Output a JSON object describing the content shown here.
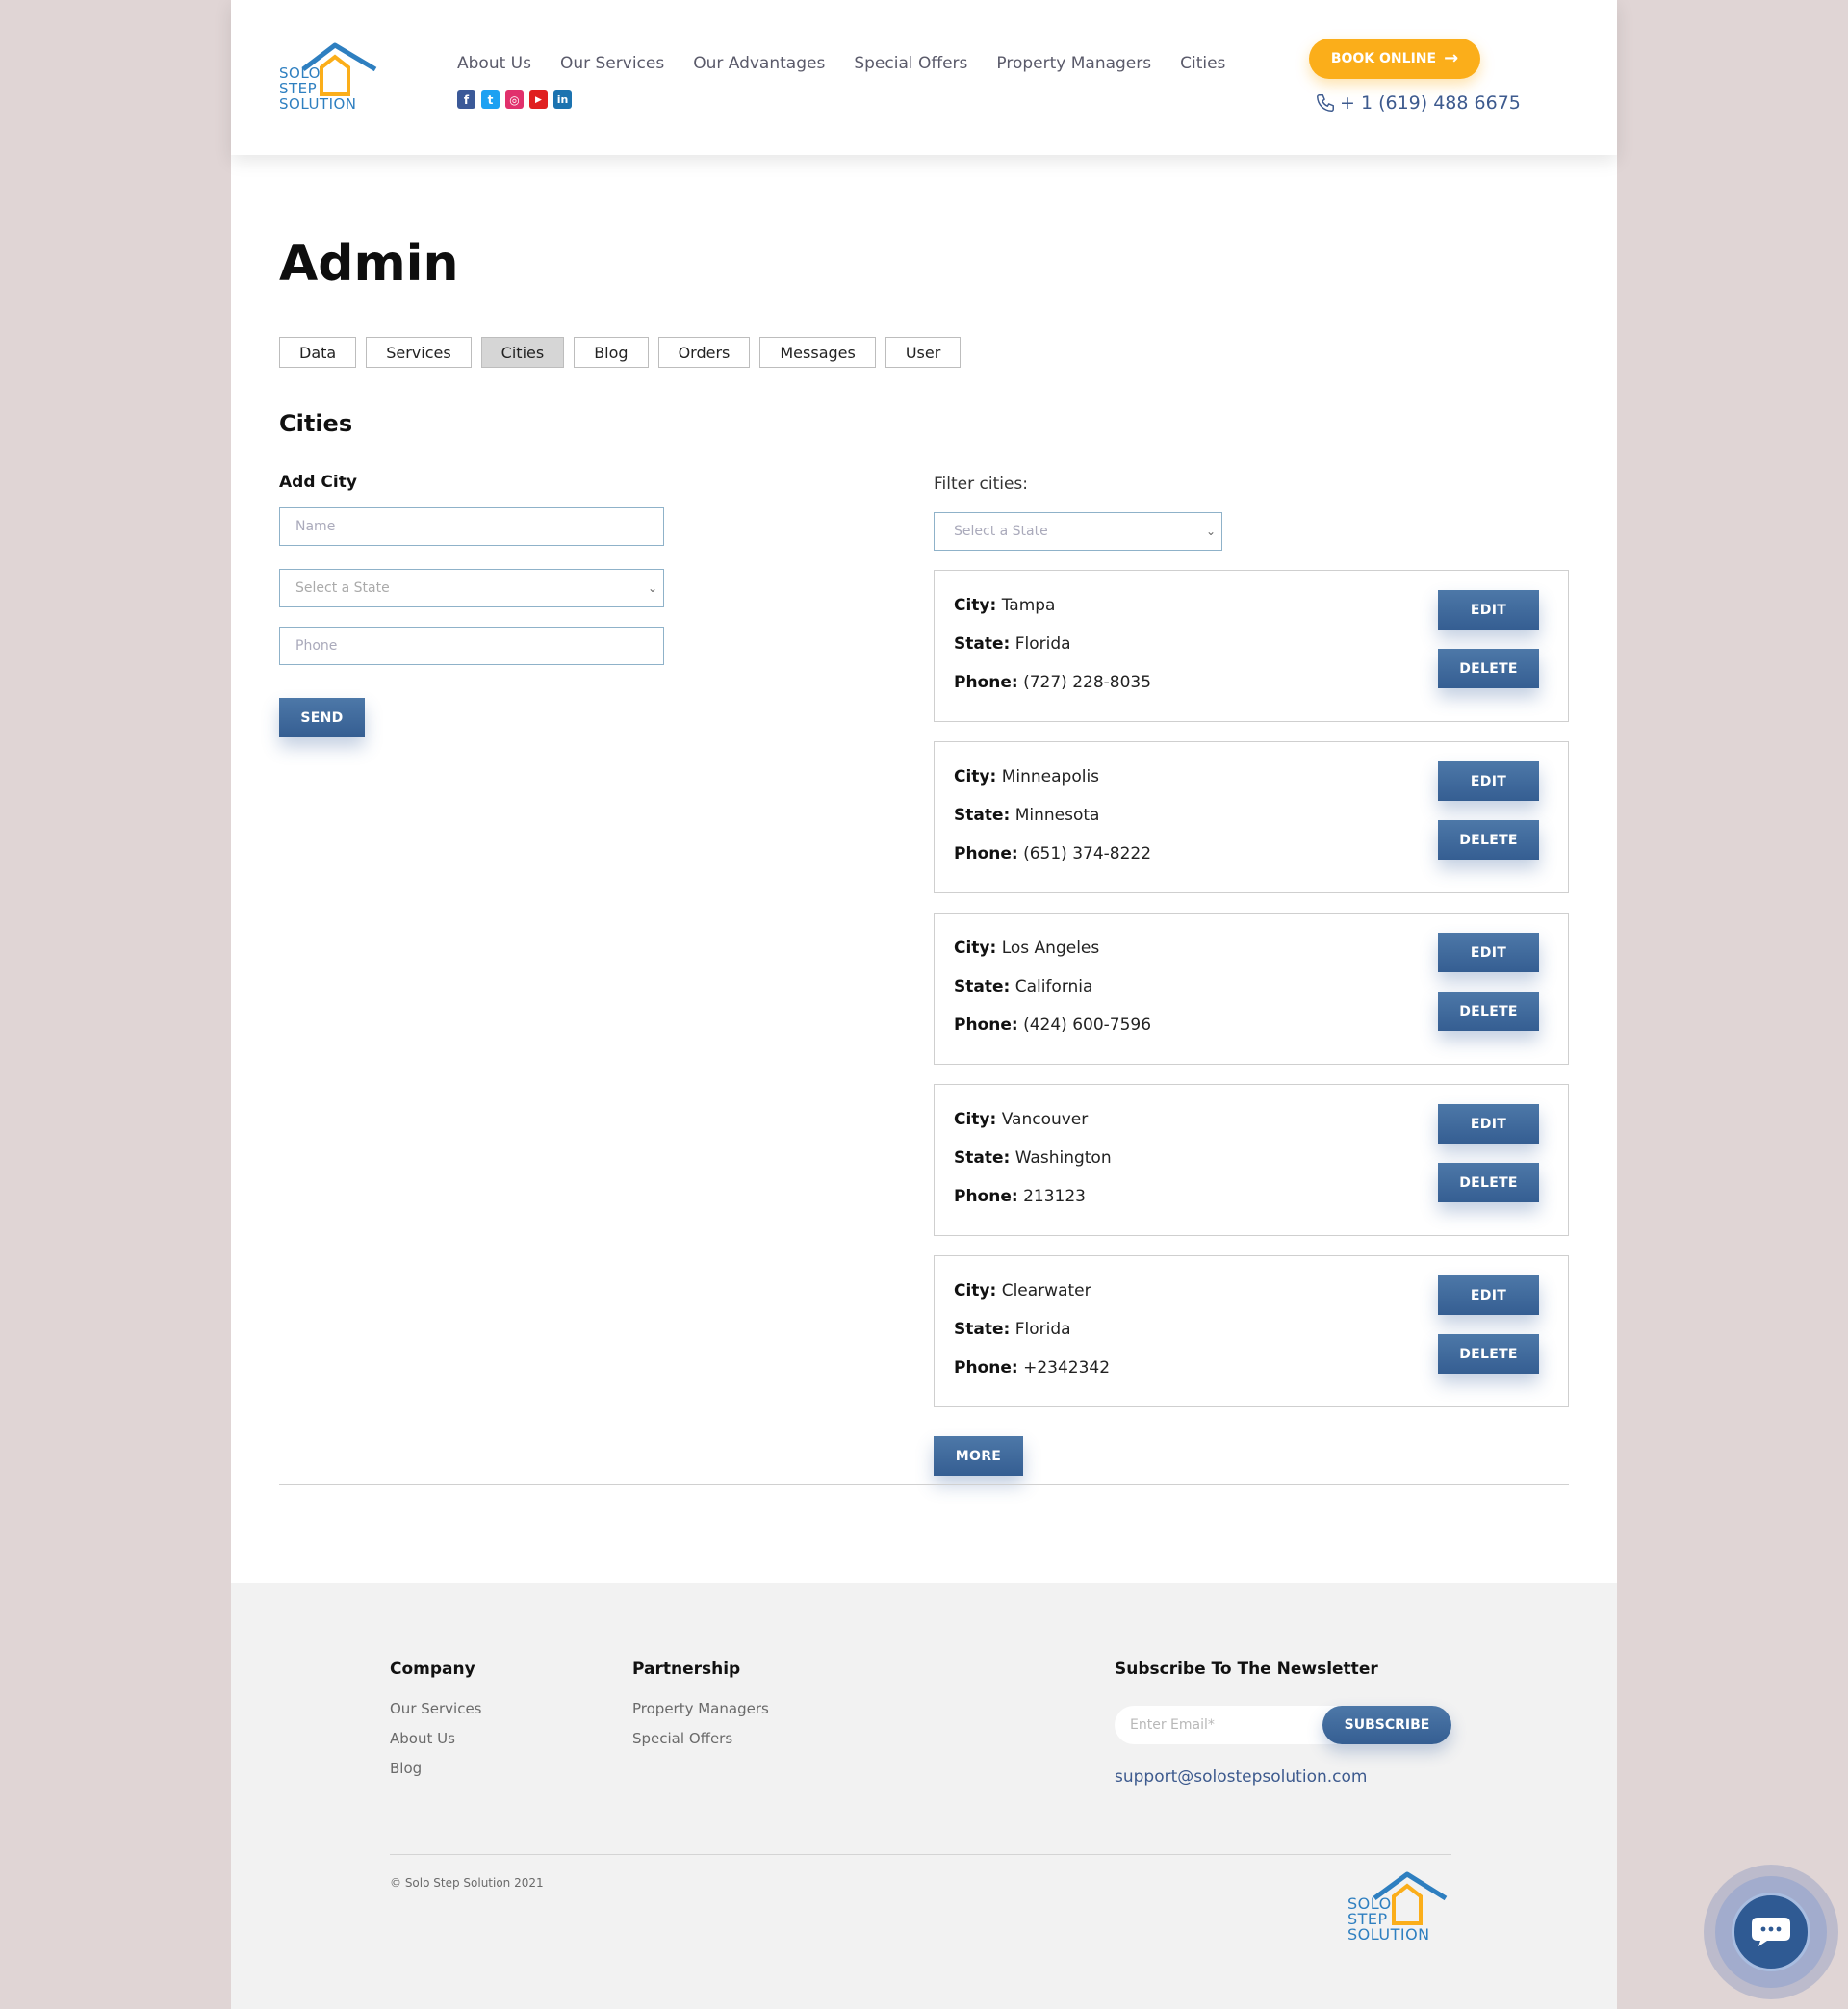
{
  "brand": {
    "logo_line1": "SOLO",
    "logo_line2": "STEP",
    "logo_line3": "SOLUTION",
    "color_blue": "#2e7fc0",
    "color_orange": "#fbae1a",
    "color_navy": "#3d5a8e"
  },
  "header": {
    "nav": [
      "About Us",
      "Our Services",
      "Our Advantages",
      "Special Offers",
      "Property Managers",
      "Cities"
    ],
    "socials": [
      {
        "icon": "facebook-icon",
        "glyph": "f",
        "color": "#3b5998"
      },
      {
        "icon": "twitter-icon",
        "glyph": "t",
        "color": "#1da1f2"
      },
      {
        "icon": "instagram-icon",
        "glyph": "◎",
        "color": "#e1306c"
      },
      {
        "icon": "youtube-icon",
        "glyph": "▶",
        "color": "#e02020"
      },
      {
        "icon": "linkedin-icon",
        "glyph": "in",
        "color": "#1c73b0"
      }
    ],
    "book_label": "BOOK ONLINE",
    "phone": "+ 1 (619) 488 6675"
  },
  "main": {
    "title": "Admin",
    "tabs": [
      {
        "label": "Data",
        "active": false
      },
      {
        "label": "Services",
        "active": false
      },
      {
        "label": "Cities",
        "active": true
      },
      {
        "label": "Blog",
        "active": false
      },
      {
        "label": "Orders",
        "active": false
      },
      {
        "label": "Messages",
        "active": false
      },
      {
        "label": "User",
        "active": false
      }
    ],
    "section_title": "Cities",
    "add_city": {
      "label": "Add City",
      "name_placeholder": "Name",
      "state_placeholder": "Select a State",
      "phone_placeholder": "Phone",
      "send_label": "SEND"
    },
    "filter": {
      "label": "Filter cities:",
      "select_placeholder": "Select a State"
    },
    "labels": {
      "city": "City:",
      "state": "State:",
      "phone": "Phone:"
    },
    "edit_label": "EDIT",
    "delete_label": "DELETE",
    "cities": [
      {
        "city": "Tampa",
        "state": "Florida",
        "phone": "(727) 228-8035"
      },
      {
        "city": "Minneapolis",
        "state": "Minnesota",
        "phone": "(651) 374-8222"
      },
      {
        "city": "Los Angeles",
        "state": "California",
        "phone": "(424) 600-7596"
      },
      {
        "city": "Vancouver",
        "state": "Washington",
        "phone": "213123"
      },
      {
        "city": "Clearwater",
        "state": "Florida",
        "phone": "+2342342"
      }
    ],
    "more_label": "MORE"
  },
  "footer": {
    "company_title": "Company",
    "company_links": [
      "Our Services",
      "About Us",
      "Blog"
    ],
    "partnership_title": "Partnership",
    "partnership_links": [
      "Property Managers",
      "Special Offers"
    ],
    "newsletter_title": "Subscribe To The Newsletter",
    "email_placeholder": "Enter Email*",
    "subscribe_label": "SUBSCRIBE",
    "support_email": "support@solostepsolution.com",
    "copyright": "© Solo Step Solution 2021"
  }
}
